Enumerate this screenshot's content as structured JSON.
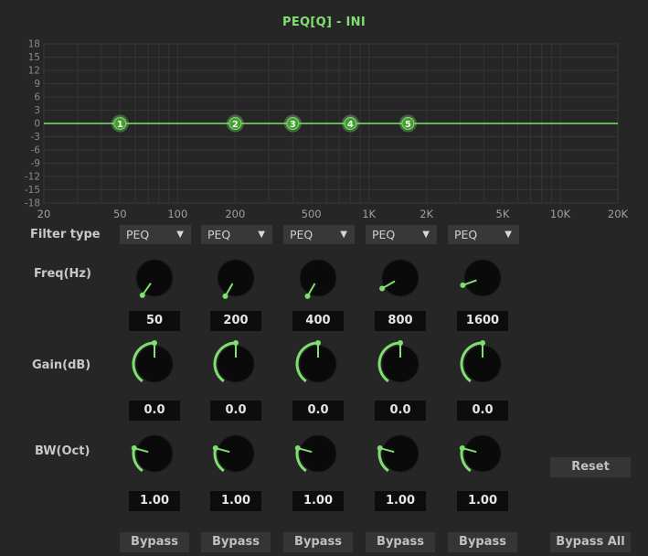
{
  "title": "PEQ[Q] - INI",
  "colors": {
    "accent": "#7fe070",
    "band_fill": "#4a9a3a",
    "background": "#262626",
    "grid": "#3a3a3a",
    "value_box": "#0d0d0d"
  },
  "graph": {
    "y_ticks": [
      "18",
      "15",
      "12",
      "9",
      "6",
      "3",
      "0",
      "-3",
      "-6",
      "-9",
      "-12",
      "-15",
      "-18"
    ],
    "x_ticks": [
      "20",
      "50",
      "100",
      "200",
      "500",
      "1K",
      "2K",
      "5K",
      "10K",
      "20K"
    ]
  },
  "labels": {
    "filter_type": "Filter type",
    "freq": "Freq(Hz)",
    "gain": "Gain(dB)",
    "bw": "BW(Oct)"
  },
  "bands": [
    {
      "number": "1",
      "type": "PEQ",
      "freq": "50",
      "gain": "0.0",
      "bw": "1.00",
      "bypass": "Bypass"
    },
    {
      "number": "2",
      "type": "PEQ",
      "freq": "200",
      "gain": "0.0",
      "bw": "1.00",
      "bypass": "Bypass"
    },
    {
      "number": "3",
      "type": "PEQ",
      "freq": "400",
      "gain": "0.0",
      "bw": "1.00",
      "bypass": "Bypass"
    },
    {
      "number": "4",
      "type": "PEQ",
      "freq": "800",
      "gain": "0.0",
      "bw": "1.00",
      "bypass": "Bypass"
    },
    {
      "number": "5",
      "type": "PEQ",
      "freq": "1600",
      "gain": "0.0",
      "bw": "1.00",
      "bypass": "Bypass"
    }
  ],
  "reset_label": "Reset",
  "bypass_all_label": "Bypass All"
}
